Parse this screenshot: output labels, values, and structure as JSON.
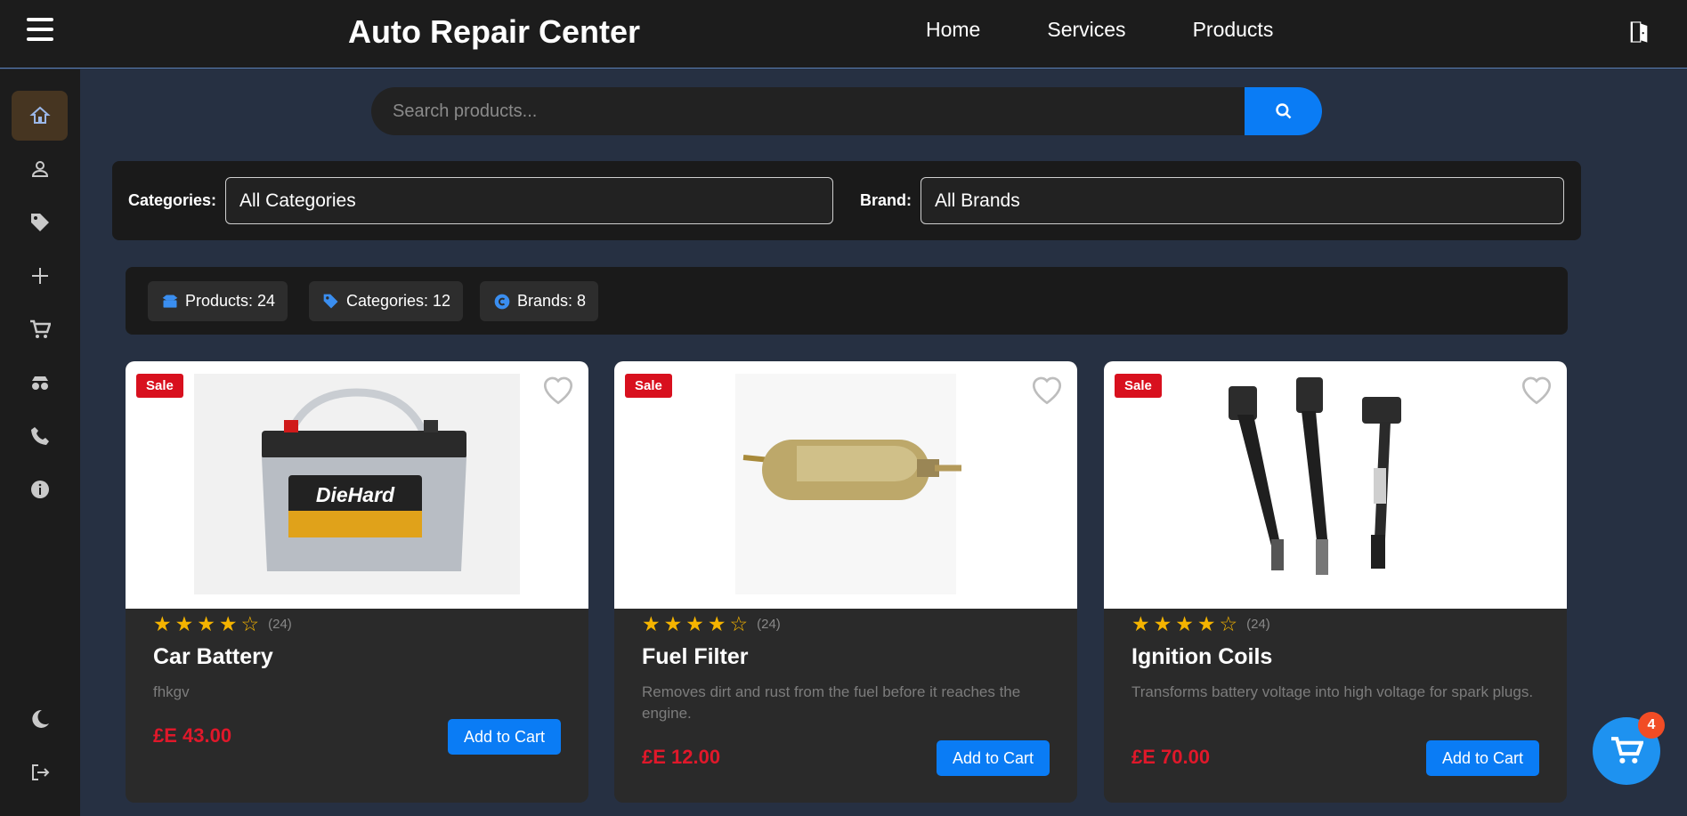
{
  "header": {
    "title": "Auto Repair Center",
    "nav": [
      "Home",
      "Services",
      "Products"
    ]
  },
  "sidebar": {
    "items": [
      "home-icon",
      "user-icon",
      "tag-icon",
      "plus-icon",
      "cart-icon",
      "car-parts-icon",
      "phone-icon",
      "info-icon"
    ],
    "bottom": [
      "moon-icon",
      "logout-icon"
    ]
  },
  "search": {
    "placeholder": "Search products..."
  },
  "filters": {
    "categories_label": "Categories:",
    "categories_value": "All Categories",
    "brand_label": "Brand:",
    "brand_value": "All Brands"
  },
  "stats": {
    "products": "Products: 24",
    "categories": "Categories: 12",
    "brands": "Brands: 8"
  },
  "products": [
    {
      "badge": "Sale",
      "rating": 4,
      "reviews": "(24)",
      "name": "Car Battery",
      "description": "fhkgv",
      "price": "£E 43.00",
      "button": "Add to Cart"
    },
    {
      "badge": "Sale",
      "rating": 4,
      "reviews": "(24)",
      "name": "Fuel Filter",
      "description": "Removes dirt and rust from the fuel before it reaches the engine.",
      "price": "£E 12.00",
      "button": "Add to Cart"
    },
    {
      "badge": "Sale",
      "rating": 4,
      "reviews": "(24)",
      "name": "Ignition Coils",
      "description": "Transforms battery voltage into high voltage for spark plugs.",
      "price": "£E 70.00",
      "button": "Add to Cart"
    }
  ],
  "cart": {
    "count": "4"
  },
  "colors": {
    "accent": "#0a7cf5",
    "price": "#e0182a",
    "sale": "#d8101e",
    "star": "#f5b400"
  }
}
